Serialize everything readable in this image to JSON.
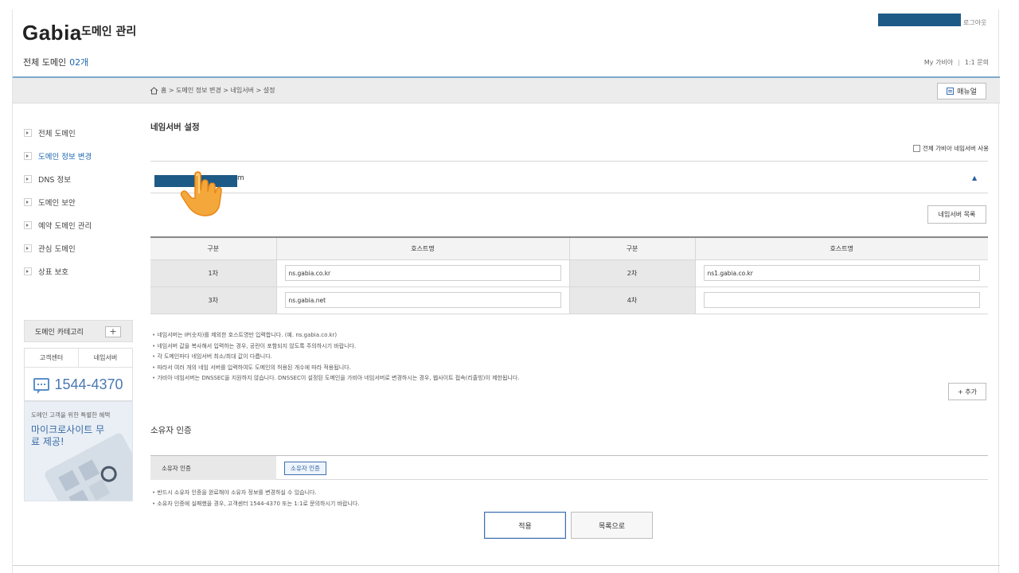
{
  "header": {
    "logo": "Gabia",
    "logo_sub": "도메인 관리",
    "total_label": "전체 도메인",
    "total_count": "02개",
    "logout": "로그아웃",
    "my_gabia": "My 가비아",
    "util_sep": "|",
    "inquiry": "1:1 문의"
  },
  "breadcrumb": {
    "text": "홈 > 도메인 정보 변경 > 네임서버 > 설정",
    "manual_label": "매뉴얼"
  },
  "sidebar": {
    "items": [
      {
        "label": "전체 도메인"
      },
      {
        "label": "도메인 정보 변경"
      },
      {
        "label": "DNS 정보"
      },
      {
        "label": "도메인 보안"
      },
      {
        "label": "예약 도메인 관리"
      },
      {
        "label": "관심 도메인"
      },
      {
        "label": "상표 보호"
      }
    ],
    "category_label": "도메인 카테고리",
    "category_plus": "+",
    "help_tabs": [
      "고객센터",
      "네임서버"
    ],
    "phone": "1544-4370",
    "promo_small": "도메인 고객을 위한 특별한 혜택",
    "promo_big": "마이크로사이트 무료 제공!"
  },
  "main": {
    "title": "네임서버 설정",
    "all_ns_label": "전체 가비아 네임서버 사용",
    "domain_tail": "m",
    "collapse_icon": "▲",
    "ns_list_button": "네임서버 목록",
    "table": {
      "headers": [
        "구분",
        "호스트명",
        "구분",
        "호스트명"
      ],
      "rows": [
        {
          "label_a": "1차",
          "host_a": "ns.gabia.co.kr",
          "label_b": "2차",
          "host_b": "ns1.gabia.co.kr"
        },
        {
          "label_a": "3차",
          "host_a": "ns.gabia.net",
          "label_b": "4차",
          "host_b": ""
        }
      ]
    },
    "notes": [
      "네임서버는 IP(숫자)를 제외한 호스트명만 입력합니다. (예. ns.gabia.co.kr)",
      "네임서버 값을 복사해서 입력하는 경우, 공란이 포함되지 않도록 주의하시기 바랍니다.",
      "각 도메인마다 네임서버 최소/최대 값이 다릅니다.",
      "따라서 여러 개의 네임 서버를 입력하여도 도메인의 허용된 개수에 따라 적용됩니다.",
      "가비아 네임서버는 DNSSEC을 지원하지 않습니다. DNSSEC이 설정된 도메인을 가비아 네임서버로 변경하시는 경우, 웹사이트 접속(리졸빙)이 제한됩니다."
    ],
    "add_button": "+ 추가",
    "owner_title": "소유자 인증",
    "owner_label": "소유자 인증",
    "owner_button": "소유자 인증",
    "owner_notes": [
      "반드시 소유자 인증을 완료해야 소유자 정보를 변경하실 수 있습니다.",
      "소유자 인증에 실패했을 경우, 고객센터 1544-4370 또는 1:1로 문의하시기 바랍니다."
    ],
    "apply_button": "적용",
    "list_button": "목록으로"
  },
  "colors": {
    "accent": "#1d66b0",
    "redaction": "#1e5a86",
    "header_line": "#7fa9c9"
  }
}
